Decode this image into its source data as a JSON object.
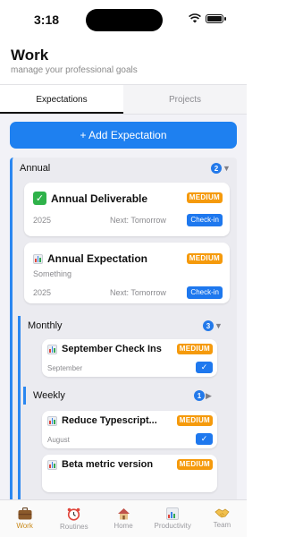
{
  "status_bar": {
    "time": "3:18"
  },
  "header": {
    "title": "Work",
    "subtitle": "manage your professional goals"
  },
  "tabs": [
    {
      "label": "Expectations",
      "active": true
    },
    {
      "label": "Projects",
      "active": false
    }
  ],
  "add_button": {
    "label": "+ Add Expectation"
  },
  "annual": {
    "title": "Annual",
    "count": "2",
    "cards": [
      {
        "title": "Annual Deliverable",
        "icon": "check-mark-icon",
        "priority": "MEDIUM",
        "year": "2025",
        "next": "Next: Tomorrow",
        "action": "Check-in"
      },
      {
        "title": "Annual Expectation",
        "icon": "bar-chart-icon",
        "priority": "MEDIUM",
        "description": "Something",
        "year": "2025",
        "next": "Next: Tomorrow",
        "action": "Check-in"
      }
    ]
  },
  "monthly": {
    "title": "Monthly",
    "count": "3",
    "cards": [
      {
        "title": "September Check Ins",
        "icon": "bar-chart-icon",
        "priority": "MEDIUM",
        "month": "September",
        "done": true
      }
    ],
    "weekly": {
      "title": "Weekly",
      "count": "1"
    },
    "cards_after": [
      {
        "title": "Reduce Typescript...",
        "icon": "bar-chart-icon",
        "priority": "MEDIUM",
        "month": "August",
        "done": true
      },
      {
        "title": "Beta metric version",
        "icon": "bar-chart-icon",
        "priority": "MEDIUM"
      }
    ]
  },
  "tab_bar": [
    {
      "label": "Work",
      "icon": "briefcase-icon",
      "active": true
    },
    {
      "label": "Routines",
      "icon": "alarm-clock-icon",
      "active": false
    },
    {
      "label": "Home",
      "icon": "house-icon",
      "active": false
    },
    {
      "label": "Productivity",
      "icon": "bar-chart-icon",
      "active": false
    },
    {
      "label": "Team",
      "icon": "handshake-icon",
      "active": false
    }
  ],
  "colors": {
    "accent": "#1e80f0",
    "priority": "#f59a0c",
    "active_tab": "#c98a1c"
  }
}
